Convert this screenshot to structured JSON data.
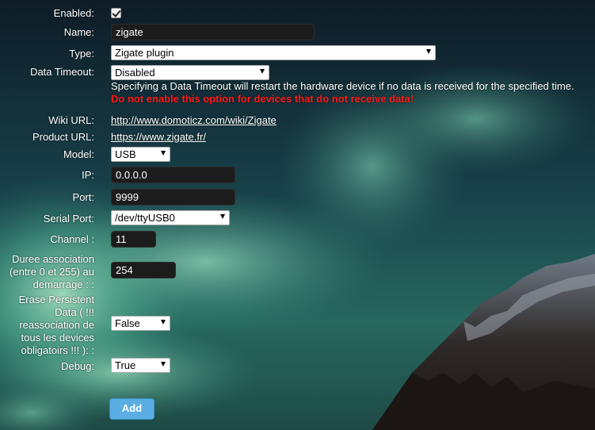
{
  "form": {
    "enabled": {
      "label": "Enabled:",
      "checked": true
    },
    "name": {
      "label": "Name:",
      "value": "zigate"
    },
    "type": {
      "label": "Type:",
      "value": "Zigate plugin"
    },
    "data_timeout": {
      "label": "Data Timeout:",
      "value": "Disabled",
      "info": "Specifying a Data Timeout will restart the hardware device if no data is received for the specified time.",
      "warning": "Do not enable this option for devices that do not receive data!"
    },
    "wiki_url": {
      "label": "Wiki URL:",
      "value": "http://www.domoticz.com/wiki/Zigate"
    },
    "product_url": {
      "label": "Product URL:",
      "value": "https://www.zigate.fr/"
    },
    "model": {
      "label": "Model:",
      "value": "USB"
    },
    "ip": {
      "label": "IP:",
      "value": "0.0.0.0"
    },
    "port": {
      "label": "Port:",
      "value": "9999"
    },
    "serial_port": {
      "label": "Serial Port:",
      "value": "/dev/ttyUSB0"
    },
    "channel": {
      "label": "Channel :",
      "value": "11"
    },
    "duree_association": {
      "label_lines": [
        "Duree association",
        "(entre 0 et 255) au",
        "demarrage : :"
      ],
      "value": "254"
    },
    "erase_persistent": {
      "label_lines": [
        "Erase Persistent",
        "Data ( !!!",
        "reassociation de",
        "tous les devices",
        "obligatoirs !!! ): :"
      ],
      "value": "False"
    },
    "debug": {
      "label": "Debug:",
      "value": "True"
    },
    "add_button": "Add"
  },
  "colors": {
    "warning_text": "#ff1a1a",
    "button_bg": "#5aaee3",
    "input_bg": "#1c1c1c"
  }
}
